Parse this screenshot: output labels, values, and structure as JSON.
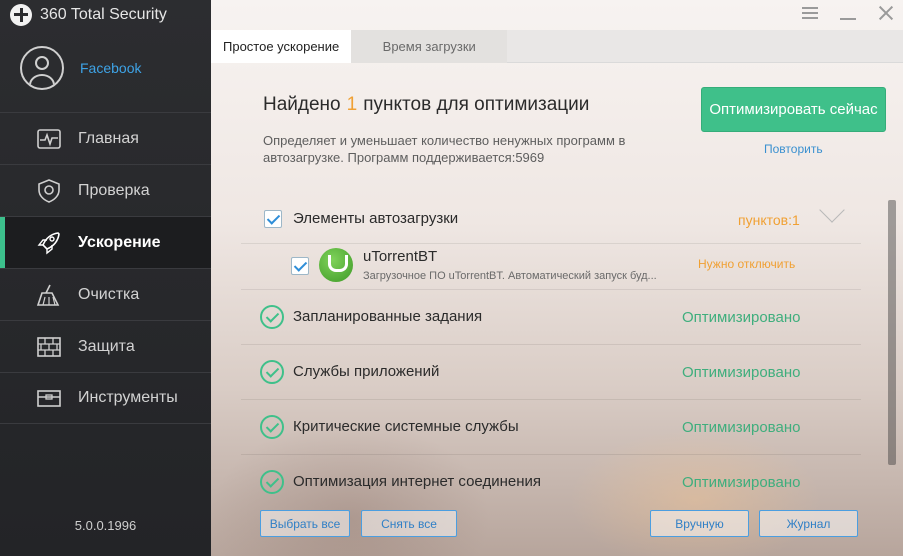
{
  "app": {
    "title": "360 Total Security",
    "version": "5.0.0.1996"
  },
  "profile": {
    "link_label": "Facebook"
  },
  "sidebar": {
    "items": [
      {
        "label": "Главная",
        "icon": "pulse-icon"
      },
      {
        "label": "Проверка",
        "icon": "shield-icon"
      },
      {
        "label": "Ускорение",
        "icon": "rocket-icon"
      },
      {
        "label": "Очистка",
        "icon": "broom-icon"
      },
      {
        "label": "Защита",
        "icon": "firewall-icon"
      },
      {
        "label": "Инструменты",
        "icon": "toolbox-icon"
      }
    ],
    "active_index": 2
  },
  "tabs": [
    {
      "label": "Простое ускорение",
      "active": true
    },
    {
      "label": "Время загрузки",
      "active": false
    }
  ],
  "summary": {
    "prefix": "Найдено",
    "count": "1",
    "suffix": "пунктов для оптимизации",
    "description": "Определяет и уменьшает количество ненужных программ в автозагрузке. Программ поддерживается:5969",
    "optimize_button": "Оптимизировать сейчас",
    "retry_link": "Повторить"
  },
  "startup_group": {
    "label": "Элементы автозагрузки",
    "count_label": "пунктов:1",
    "item": {
      "name": "uTorrentBT",
      "description": "Загрузочное ПО uTorrentBT. Автоматический запуск буд...",
      "status": "Нужно отключить"
    }
  },
  "categories": [
    {
      "label": "Запланированные задания",
      "status": "Оптимизировано"
    },
    {
      "label": "Службы приложений",
      "status": "Оптимизировано"
    },
    {
      "label": "Критические системные службы",
      "status": "Оптимизировано"
    },
    {
      "label": "Оптимизация интернет соединения",
      "status": "Оптимизировано"
    }
  ],
  "footer": {
    "select_all": "Выбрать все",
    "deselect_all": "Снять все",
    "manual": "Вручную",
    "log": "Журнал"
  },
  "colors": {
    "accent_green": "#3fc08a",
    "accent_orange": "#f0a033",
    "link_blue": "#3a90d0"
  }
}
